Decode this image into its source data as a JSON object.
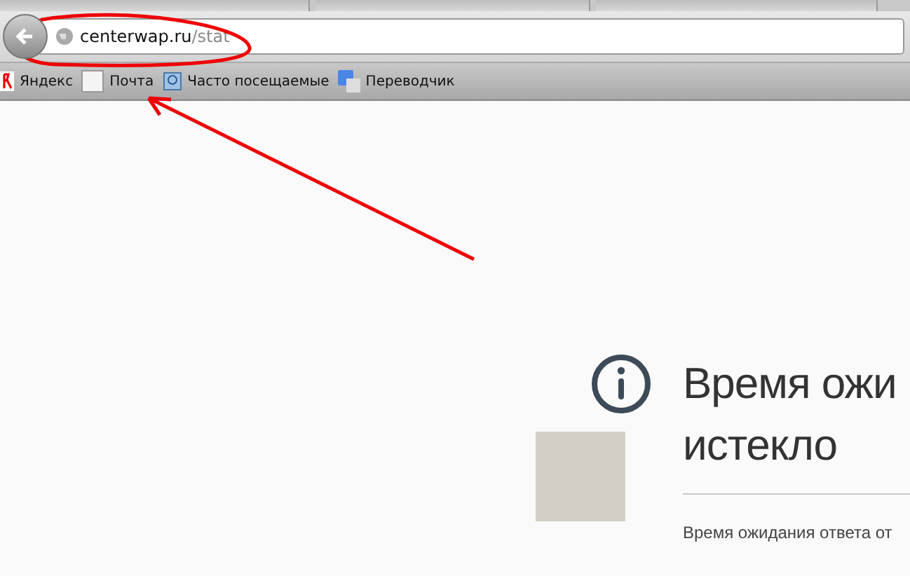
{
  "address_bar": {
    "host": "centerwap.ru",
    "path": "/stat"
  },
  "bookmarks": [
    {
      "label": "Яндекс",
      "kind": "yandex"
    },
    {
      "label": "Почта",
      "kind": "blank"
    },
    {
      "label": "Часто посещаемые",
      "kind": "frequent"
    },
    {
      "label": "Переводчик",
      "kind": "translate"
    }
  ],
  "error": {
    "title_lines": [
      "Время ожи",
      "истекло"
    ],
    "message": "Время ожидания ответа от"
  }
}
